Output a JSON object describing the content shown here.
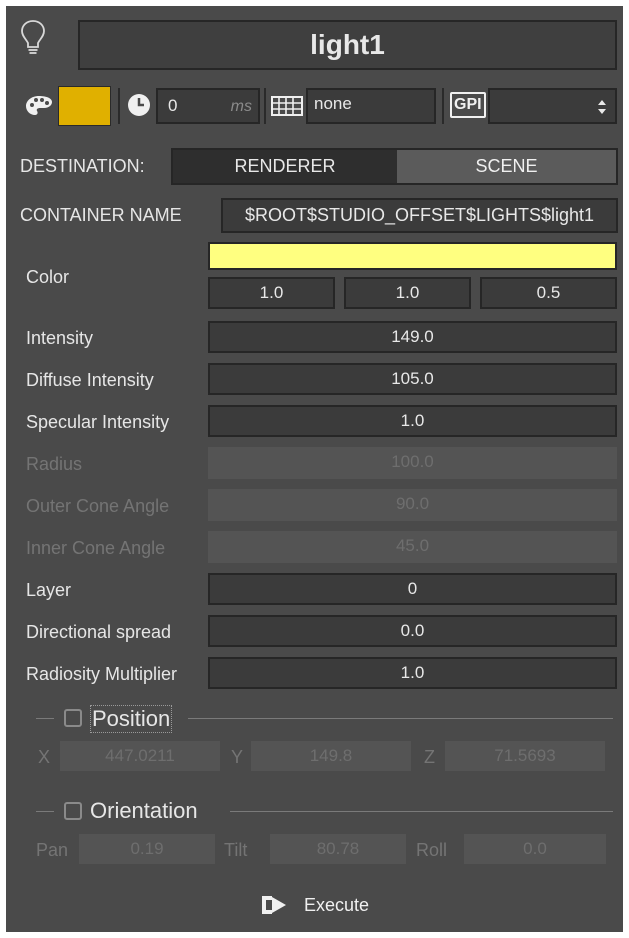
{
  "header": {
    "icon": "lightbulb-icon",
    "name": "light1",
    "palette_icon": "palette-icon",
    "swatch_color": "#e0b000",
    "clock_icon": "clock-icon",
    "delay_value": "0",
    "delay_unit": "ms",
    "keyboard_icon": "keyboard-icon",
    "keyboard_value": "none",
    "gpi_label": "GPI",
    "gpi_value": ""
  },
  "destination": {
    "label": "DESTINATION:",
    "options": [
      "RENDERER",
      "SCENE"
    ],
    "selected": "RENDERER"
  },
  "container": {
    "label": "CONTAINER NAME",
    "value": "$ROOT$STUDIO_OFFSET$LIGHTS$light1"
  },
  "color": {
    "label": "Color",
    "swatch": "#ffff80",
    "r": "1.0",
    "g": "1.0",
    "b": "0.5"
  },
  "properties": [
    {
      "label": "Intensity",
      "value": "149.0",
      "enabled": true
    },
    {
      "label": "Diffuse Intensity",
      "value": "105.0",
      "enabled": true
    },
    {
      "label": "Specular Intensity",
      "value": "1.0",
      "enabled": true
    },
    {
      "label": "Radius",
      "value": "100.0",
      "enabled": false
    },
    {
      "label": "Outer Cone Angle",
      "value": "90.0",
      "enabled": false
    },
    {
      "label": "Inner Cone Angle",
      "value": "45.0",
      "enabled": false
    },
    {
      "label": "Layer",
      "value": "0",
      "enabled": true
    },
    {
      "label": "Directional spread",
      "value": "0.0",
      "enabled": true
    },
    {
      "label": "Radiosity Multiplier",
      "value": "1.0",
      "enabled": true
    }
  ],
  "position": {
    "title": "Position",
    "checked": false,
    "x_label": "X",
    "x": "447.0211",
    "y_label": "Y",
    "y": "149.8",
    "z_label": "Z",
    "z": "71.5693"
  },
  "orientation": {
    "title": "Orientation",
    "checked": false,
    "pan_label": "Pan",
    "pan": "0.19",
    "tilt_label": "Tilt",
    "tilt": "80.78",
    "roll_label": "Roll",
    "roll": "0.0"
  },
  "execute": {
    "icon": "execute-icon",
    "label": "Execute"
  }
}
